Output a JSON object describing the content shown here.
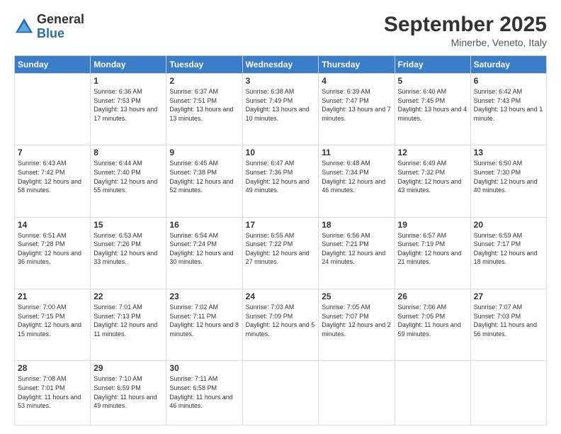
{
  "header": {
    "logo_general": "General",
    "logo_blue": "Blue",
    "month_title": "September 2025",
    "location": "Minerbe, Veneto, Italy"
  },
  "weekdays": [
    "Sunday",
    "Monday",
    "Tuesday",
    "Wednesday",
    "Thursday",
    "Friday",
    "Saturday"
  ],
  "weeks": [
    [
      {
        "day": "",
        "sunrise": "",
        "sunset": "",
        "daylight": ""
      },
      {
        "day": "1",
        "sunrise": "Sunrise: 6:36 AM",
        "sunset": "Sunset: 7:53 PM",
        "daylight": "Daylight: 13 hours and 17 minutes."
      },
      {
        "day": "2",
        "sunrise": "Sunrise: 6:37 AM",
        "sunset": "Sunset: 7:51 PM",
        "daylight": "Daylight: 13 hours and 13 minutes."
      },
      {
        "day": "3",
        "sunrise": "Sunrise: 6:38 AM",
        "sunset": "Sunset: 7:49 PM",
        "daylight": "Daylight: 13 hours and 10 minutes."
      },
      {
        "day": "4",
        "sunrise": "Sunrise: 6:39 AM",
        "sunset": "Sunset: 7:47 PM",
        "daylight": "Daylight: 13 hours and 7 minutes."
      },
      {
        "day": "5",
        "sunrise": "Sunrise: 6:40 AM",
        "sunset": "Sunset: 7:45 PM",
        "daylight": "Daylight: 13 hours and 4 minutes."
      },
      {
        "day": "6",
        "sunrise": "Sunrise: 6:42 AM",
        "sunset": "Sunset: 7:43 PM",
        "daylight": "Daylight: 13 hours and 1 minute."
      }
    ],
    [
      {
        "day": "7",
        "sunrise": "Sunrise: 6:43 AM",
        "sunset": "Sunset: 7:42 PM",
        "daylight": "Daylight: 12 hours and 58 minutes."
      },
      {
        "day": "8",
        "sunrise": "Sunrise: 6:44 AM",
        "sunset": "Sunset: 7:40 PM",
        "daylight": "Daylight: 12 hours and 55 minutes."
      },
      {
        "day": "9",
        "sunrise": "Sunrise: 6:45 AM",
        "sunset": "Sunset: 7:38 PM",
        "daylight": "Daylight: 12 hours and 52 minutes."
      },
      {
        "day": "10",
        "sunrise": "Sunrise: 6:47 AM",
        "sunset": "Sunset: 7:36 PM",
        "daylight": "Daylight: 12 hours and 49 minutes."
      },
      {
        "day": "11",
        "sunrise": "Sunrise: 6:48 AM",
        "sunset": "Sunset: 7:34 PM",
        "daylight": "Daylight: 12 hours and 46 minutes."
      },
      {
        "day": "12",
        "sunrise": "Sunrise: 6:49 AM",
        "sunset": "Sunset: 7:32 PM",
        "daylight": "Daylight: 12 hours and 43 minutes."
      },
      {
        "day": "13",
        "sunrise": "Sunrise: 6:50 AM",
        "sunset": "Sunset: 7:30 PM",
        "daylight": "Daylight: 12 hours and 40 minutes."
      }
    ],
    [
      {
        "day": "14",
        "sunrise": "Sunrise: 6:51 AM",
        "sunset": "Sunset: 7:28 PM",
        "daylight": "Daylight: 12 hours and 36 minutes."
      },
      {
        "day": "15",
        "sunrise": "Sunrise: 6:53 AM",
        "sunset": "Sunset: 7:26 PM",
        "daylight": "Daylight: 12 hours and 33 minutes."
      },
      {
        "day": "16",
        "sunrise": "Sunrise: 6:54 AM",
        "sunset": "Sunset: 7:24 PM",
        "daylight": "Daylight: 12 hours and 30 minutes."
      },
      {
        "day": "17",
        "sunrise": "Sunrise: 6:55 AM",
        "sunset": "Sunset: 7:22 PM",
        "daylight": "Daylight: 12 hours and 27 minutes."
      },
      {
        "day": "18",
        "sunrise": "Sunrise: 6:56 AM",
        "sunset": "Sunset: 7:21 PM",
        "daylight": "Daylight: 12 hours and 24 minutes."
      },
      {
        "day": "19",
        "sunrise": "Sunrise: 6:57 AM",
        "sunset": "Sunset: 7:19 PM",
        "daylight": "Daylight: 12 hours and 21 minutes."
      },
      {
        "day": "20",
        "sunrise": "Sunrise: 6:59 AM",
        "sunset": "Sunset: 7:17 PM",
        "daylight": "Daylight: 12 hours and 18 minutes."
      }
    ],
    [
      {
        "day": "21",
        "sunrise": "Sunrise: 7:00 AM",
        "sunset": "Sunset: 7:15 PM",
        "daylight": "Daylight: 12 hours and 15 minutes."
      },
      {
        "day": "22",
        "sunrise": "Sunrise: 7:01 AM",
        "sunset": "Sunset: 7:13 PM",
        "daylight": "Daylight: 12 hours and 11 minutes."
      },
      {
        "day": "23",
        "sunrise": "Sunrise: 7:02 AM",
        "sunset": "Sunset: 7:11 PM",
        "daylight": "Daylight: 12 hours and 8 minutes."
      },
      {
        "day": "24",
        "sunrise": "Sunrise: 7:03 AM",
        "sunset": "Sunset: 7:09 PM",
        "daylight": "Daylight: 12 hours and 5 minutes."
      },
      {
        "day": "25",
        "sunrise": "Sunrise: 7:05 AM",
        "sunset": "Sunset: 7:07 PM",
        "daylight": "Daylight: 12 hours and 2 minutes."
      },
      {
        "day": "26",
        "sunrise": "Sunrise: 7:06 AM",
        "sunset": "Sunset: 7:05 PM",
        "daylight": "Daylight: 11 hours and 59 minutes."
      },
      {
        "day": "27",
        "sunrise": "Sunrise: 7:07 AM",
        "sunset": "Sunset: 7:03 PM",
        "daylight": "Daylight: 11 hours and 56 minutes."
      }
    ],
    [
      {
        "day": "28",
        "sunrise": "Sunrise: 7:08 AM",
        "sunset": "Sunset: 7:01 PM",
        "daylight": "Daylight: 11 hours and 53 minutes."
      },
      {
        "day": "29",
        "sunrise": "Sunrise: 7:10 AM",
        "sunset": "Sunset: 6:59 PM",
        "daylight": "Daylight: 11 hours and 49 minutes."
      },
      {
        "day": "30",
        "sunrise": "Sunrise: 7:11 AM",
        "sunset": "Sunset: 6:58 PM",
        "daylight": "Daylight: 11 hours and 46 minutes."
      },
      {
        "day": "",
        "sunrise": "",
        "sunset": "",
        "daylight": ""
      },
      {
        "day": "",
        "sunrise": "",
        "sunset": "",
        "daylight": ""
      },
      {
        "day": "",
        "sunrise": "",
        "sunset": "",
        "daylight": ""
      },
      {
        "day": "",
        "sunrise": "",
        "sunset": "",
        "daylight": ""
      }
    ]
  ]
}
